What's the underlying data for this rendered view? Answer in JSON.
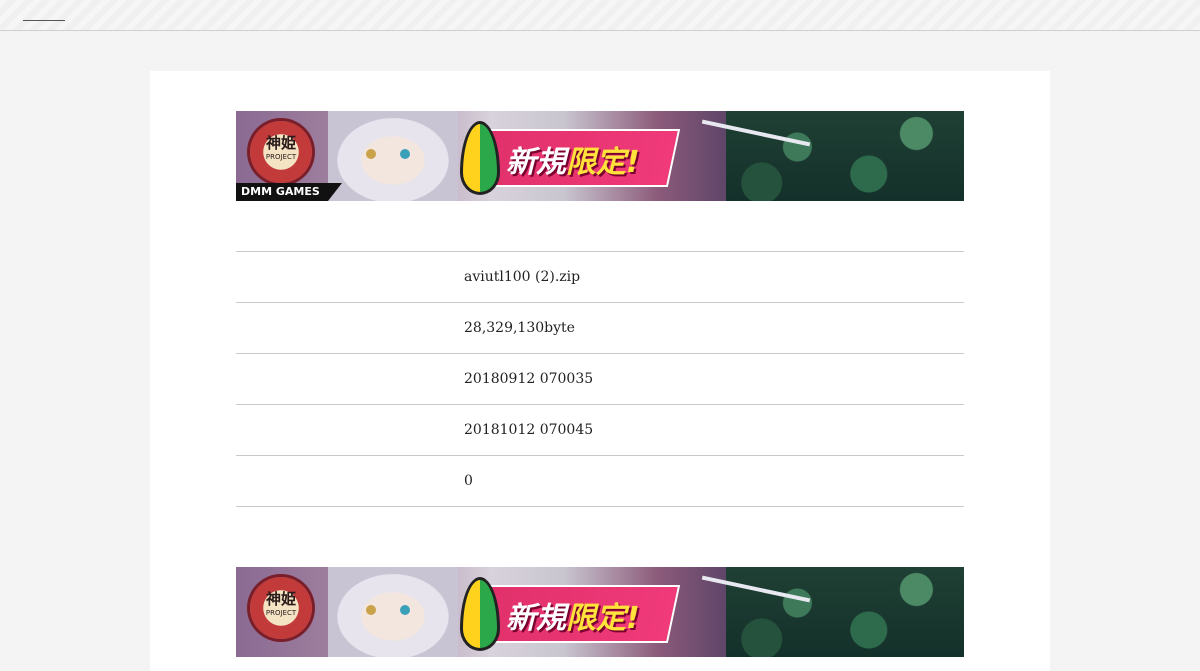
{
  "banner": {
    "emblem_title": "神姫",
    "emblem_sub": "PROJECT",
    "promo_white": "新規",
    "promo_highlight": "限定!",
    "brand": "DMM GAMES"
  },
  "file_info": {
    "rows": [
      {
        "key": "",
        "value": "aviutl100 (2).zip"
      },
      {
        "key": "",
        "value": "28,329,130byte"
      },
      {
        "key": "",
        "value": "20180912 070035"
      },
      {
        "key": "",
        "value": "20181012 070045"
      },
      {
        "key": "",
        "value": "0"
      }
    ]
  }
}
